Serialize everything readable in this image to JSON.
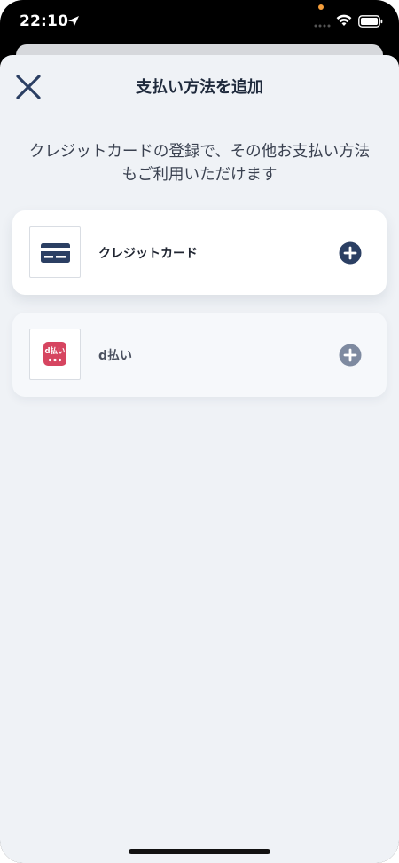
{
  "status_bar": {
    "time": "22:10",
    "icons": [
      "location-arrow-icon",
      "signal-icon",
      "wifi-icon",
      "battery-icon"
    ],
    "privacy_dot_color": "#f59e3b"
  },
  "header": {
    "title": "支払い方法を追加",
    "close_icon": "close-icon"
  },
  "description": {
    "line1": "クレジットカードの登録で、その他お支払い方法",
    "line2": "もご利用いただけます"
  },
  "methods": [
    {
      "label": "クレジットカード",
      "icon": "credit-card-icon",
      "action_icon": "add-circle-icon",
      "accent_color": "#2b3f63"
    },
    {
      "label": "d払い",
      "icon": "d-payment-logo",
      "logo_text": "d払い",
      "action_icon": "add-circle-icon",
      "accent_color": "#7e8aa0",
      "logo_color": "#d64560"
    }
  ],
  "colors": {
    "sheet_background": "#eff2f6",
    "primary": "#2b3f63",
    "card_background": "#ffffff"
  }
}
